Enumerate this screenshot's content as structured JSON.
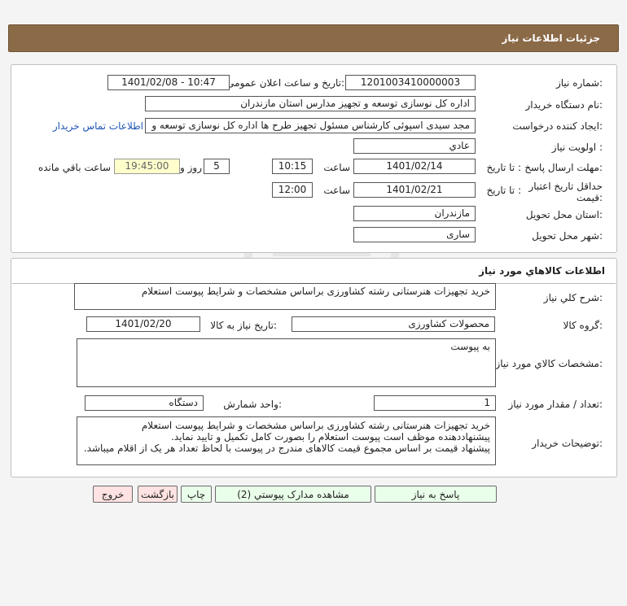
{
  "header": {
    "title": "جزئيات اطلاعات نياز"
  },
  "details": {
    "need_number_label": "شماره نياز:",
    "need_number": "1201003410000003",
    "announce_label": "تاريخ و ساعت اعلان عمومی:",
    "announce_value": "1401/02/08 - 10:47",
    "buyer_org_label": "نام دستگاه خريدار:",
    "buyer_org": "اداره کل نوسازی  توسعه و تجهیز مدارس استان مازندران",
    "creator_label": "ايجاد کننده درخواست:",
    "creator": "مجد سیدی اسپوئی کارشناس مسئول تجهیز طرح ها اداره کل نوسازی  توسعه و",
    "contact_link": "اطلاعات تماس خريدار",
    "priority_label": "اولويت نياز :",
    "priority": "عادي",
    "reply_deadline_label": "مهلت ارسال پاسخ:",
    "until_date_label": "تا تاريخ :",
    "reply_date": "1401/02/14",
    "time_label": "ساعت",
    "reply_time": "10:15",
    "days_value": "5",
    "day_and_label": "روز و",
    "remaining_time": "19:45:00",
    "remaining_label": "ساعت باقي مانده",
    "validity_label": "حداقل تاريخ اعتبار قيمت:",
    "validity_until_label": "تا تاريخ :",
    "validity_date": "1401/02/21",
    "validity_time_label": "ساعت",
    "validity_time": "12:00",
    "province_label": "استان محل تحويل:",
    "province": "مازندران",
    "city_label": "شهر محل تحويل:",
    "city": "ساری"
  },
  "goods": {
    "title": "اطلاعات کالاهاي مورد نياز",
    "summary_label": "شرح کلي نياز:",
    "summary": "خرید تجهیزات هنرستانی رشته کشاورزی براساس مشخصات و شرایط پیوست استعلام",
    "group_label": "گروه کالا:",
    "group": "محصولات کشاورزی",
    "need_date_label": "تاريخ نياز به کالا:",
    "need_date": "1401/02/20",
    "specs_label": "مشخصات کالاي مورد نياز:",
    "specs": "به پیوست",
    "qty_label": "تعداد / مقدار مورد نياز:",
    "qty": "1",
    "unit_label": "واحد شمارش:",
    "unit": "دستگاه",
    "buyer_notes_label": "توضيحات خريدار:",
    "buyer_notes": [
      "خرید تجهیزات هنرستانی رشته کشاورزی براساس مشخصات و شرایط پیوست استعلام",
      " پیشنهاددهنده موظف است پیوست استعلام را بصورت کامل  تکمیل و تایید نماید.",
      "پیشنهاد قیمت بر اساس مجموع قیمت کالاهای مندرج در پیوست با لحاظ تعداد هر یک از اقلام میباشد."
    ]
  },
  "buttons": {
    "reply": "پاسخ به نياز",
    "view_docs": "مشاهده مدارک پيوستي (2)",
    "print": "چاپ",
    "back": "بازگشت",
    "exit": "خروج"
  },
  "colors": {
    "header_bg": "#8b6a48",
    "button_green": "#eaffea",
    "button_pink": "#ffe2e2",
    "link": "#1f55b5"
  }
}
